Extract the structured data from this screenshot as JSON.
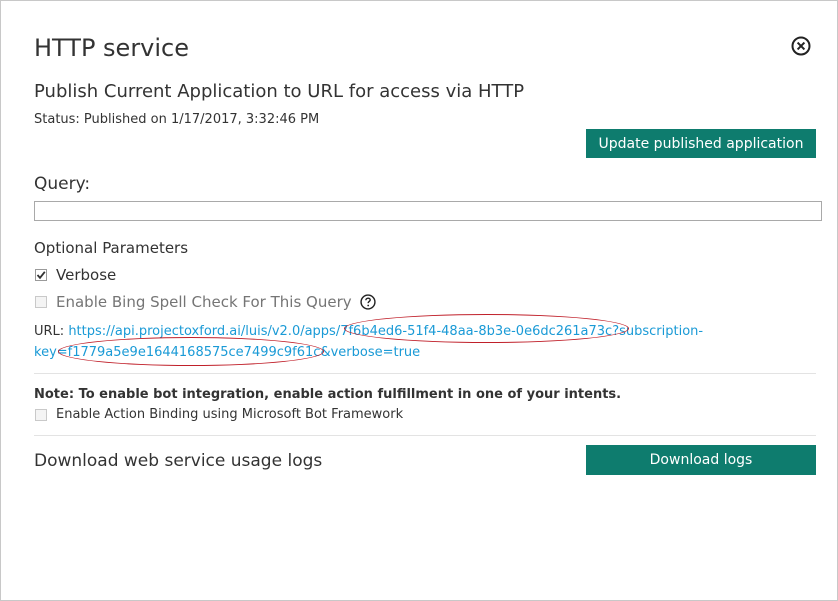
{
  "dialog": {
    "title": "HTTP service",
    "subtitle": "Publish Current Application to URL for access via HTTP",
    "status": "Status: Published on 1/17/2017, 3:32:46 PM",
    "update_button": "Update published application",
    "close_icon": "close-circle-icon"
  },
  "query": {
    "label": "Query:",
    "value": "",
    "placeholder": ""
  },
  "optional": {
    "heading": "Optional Parameters",
    "verbose_label": "Verbose",
    "verbose_checked": true,
    "bing_label": "Enable Bing Spell Check For This Query",
    "bing_checked": false,
    "help_icon": "question-circle-icon"
  },
  "url": {
    "label": "URL:",
    "line1_link": "https://api.projectoxford.ai/luis/v2.0/apps/7f6b4ed6-51f4-48aa-8b3e-0e6dc261a73c?subscription-",
    "line2_link": "key=f1779a5e9e1644168575ce7499c9f61c&verbose=true"
  },
  "bot": {
    "note": "Note: To enable bot integration, enable action fulfillment in one of your intents.",
    "action_binding_label": "Enable Action Binding using Microsoft Bot Framework",
    "action_binding_checked": false
  },
  "logs": {
    "label": "Download web service usage logs",
    "button": "Download logs"
  },
  "colors": {
    "accent": "#0e7c6e",
    "link": "#1a9ad6",
    "annotation": "#c0202a"
  }
}
